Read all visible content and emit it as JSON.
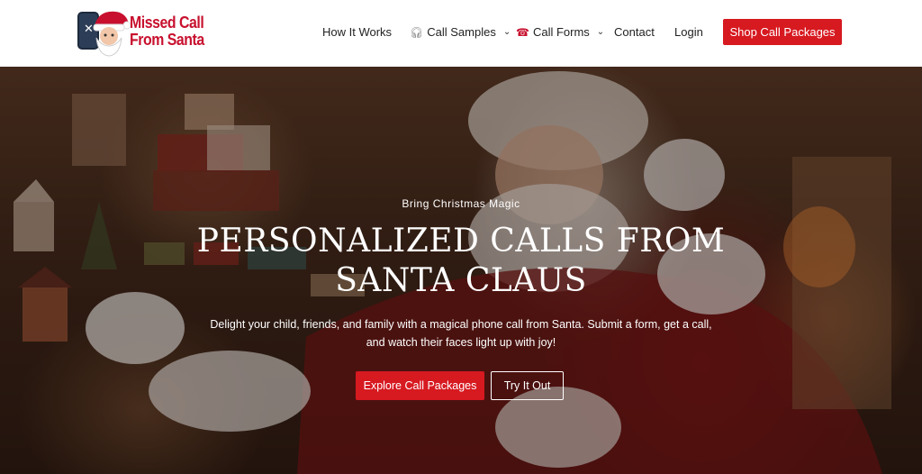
{
  "brand": {
    "logo_line1": "Missed Call",
    "logo_line2": "From Santa",
    "accent_color": "#d71920"
  },
  "nav": {
    "items": [
      {
        "label": "How It Works"
      },
      {
        "label": "Call Samples",
        "icon": "headphones-icon",
        "has_dropdown": true
      },
      {
        "label": "Call Forms",
        "icon": "phone-icon",
        "has_dropdown": true
      },
      {
        "label": "Contact"
      },
      {
        "label": "Login"
      }
    ],
    "cta_label": "Shop Call Packages"
  },
  "hero": {
    "eyebrow": "Bring Christmas Magic",
    "title": "PERSONALIZED CALLS FROM SANTA CLAUS",
    "subtitle": "Delight your child, friends, and family with a magical phone call from Santa. Submit a form, get a call, and watch their faces light up with joy!",
    "primary_button": "Explore Call Packages",
    "secondary_button": "Try It Out"
  }
}
